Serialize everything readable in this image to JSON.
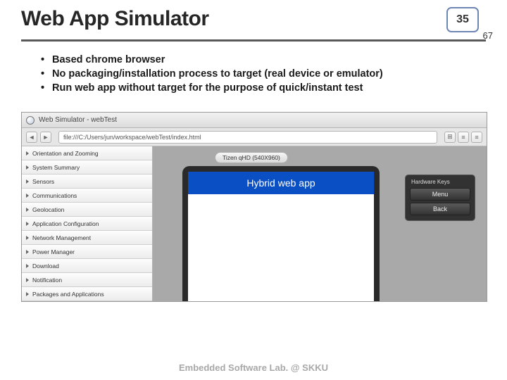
{
  "title": "Web App Simulator",
  "page": {
    "current": "35",
    "total": "67"
  },
  "bullets": [
    "Based chrome browser",
    "No packaging/installation process to target (real device or emulator)",
    "Run web app without target for the purpose of quick/instant test"
  ],
  "simulator": {
    "window_title": "Web Simulator - webTest",
    "url": "file:///C:/Users/jun/workspace/webTest/index.html",
    "sidebar_items": [
      "Orientation and Zooming",
      "System Summary",
      "Sensors",
      "Communications",
      "Geolocation",
      "Application Configuration",
      "Network Management",
      "Power Manager",
      "Download",
      "Notification",
      "Packages and Applications"
    ],
    "device_label": "Tizen qHD (540X960)",
    "app_title": "Hybrid web app",
    "hwkeys": {
      "title": "Hardware Keys",
      "menu": "Menu",
      "back": "Back"
    }
  },
  "footer": "Embedded Software Lab. @ SKKU"
}
